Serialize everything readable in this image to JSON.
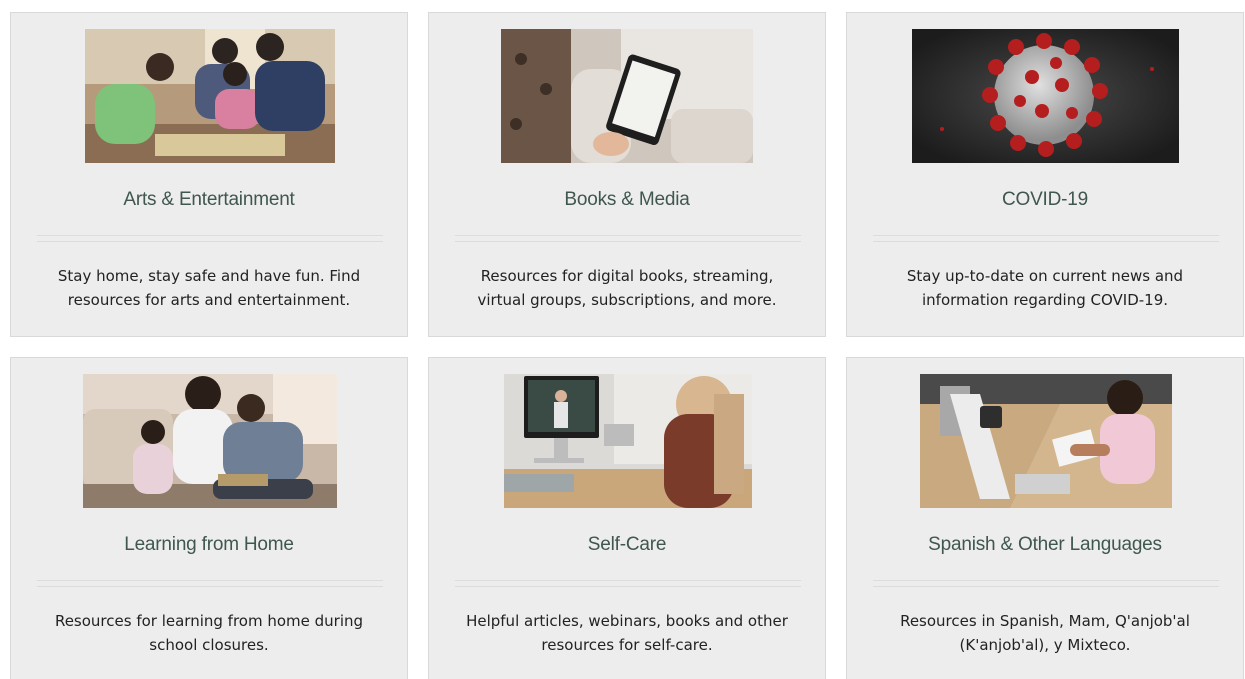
{
  "cards": [
    {
      "title": "Arts & Entertainment",
      "description": "Stay home, stay safe and have fun. Find resources for arts and entertainment.",
      "image": "family-board-game-photo"
    },
    {
      "title": "Books & Media",
      "description": "Resources for digital books, streaming, virtual groups, subscriptions, and more.",
      "image": "tablet-reading-photo"
    },
    {
      "title": "COVID-19",
      "description": "Stay up-to-date on current news and information regarding COVID-19.",
      "image": "coronavirus-illustration"
    },
    {
      "title": "Learning from Home",
      "description": "Resources for learning from home during school closures.",
      "image": "family-reading-photo"
    },
    {
      "title": "Self-Care",
      "description": "Helpful articles, webinars, books and other resources for self-care.",
      "image": "video-call-photo"
    },
    {
      "title": "Spanish & Other Languages",
      "description": "Resources in Spanish, Mam, Q'anjob'al (K'anjob'al), y Mixteco.",
      "image": "girl-studying-photo"
    }
  ],
  "colors": {
    "card_background": "#eeeded",
    "title": "#3f5750",
    "text": "#222222",
    "border": "#d9d9d9"
  }
}
